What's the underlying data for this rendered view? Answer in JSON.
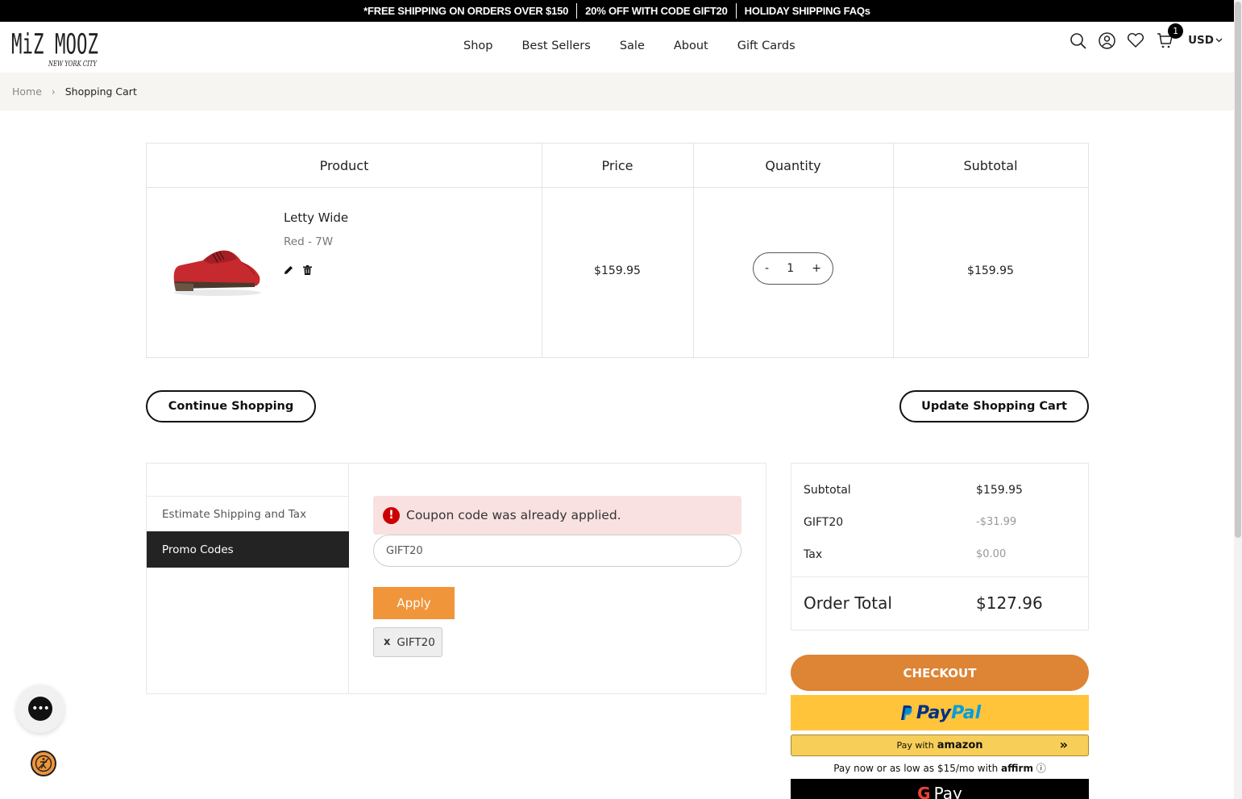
{
  "announcement": {
    "items": [
      "*FREE SHIPPING ON ORDERS OVER $150",
      "20% OFF WITH CODE GIFT20",
      "HOLIDAY SHIPPING FAQs"
    ]
  },
  "header": {
    "logo_main": "MiZ MOOZ",
    "logo_sub": "NEW YORK CITY",
    "nav": [
      "Shop",
      "Best Sellers",
      "Sale",
      "About",
      "Gift Cards"
    ],
    "cart_count": "1",
    "currency": "USD",
    "icons": [
      "search-icon",
      "account-icon",
      "wishlist-heart-icon",
      "cart-icon",
      "chevron-down-icon"
    ]
  },
  "breadcrumb": {
    "home": "Home",
    "current": "Shopping Cart"
  },
  "cart": {
    "headers": {
      "product": "Product",
      "price": "Price",
      "quantity": "Quantity",
      "subtotal": "Subtotal"
    },
    "items": [
      {
        "name": "Letty Wide",
        "variant": "Red  - 7W",
        "price": "$159.95",
        "quantity": "1",
        "subtotal": "$159.95",
        "image": "red-oxford-shoe"
      }
    ],
    "qty_minus": "-",
    "qty_plus": "+"
  },
  "actions": {
    "continue": "Continue Shopping",
    "update": "Update Shopping Cart"
  },
  "promo": {
    "tabs": [
      "Estimate Shipping and Tax",
      "Promo Codes"
    ],
    "alert": "Coupon code was already applied.",
    "input_value": "GIFT20",
    "apply": "Apply",
    "applied_code": "GIFT20",
    "remove_symbol": "x"
  },
  "summary": {
    "rows": [
      {
        "label": "Subtotal",
        "value": "$159.95"
      },
      {
        "label": "GIFT20",
        "value": "-$31.99"
      },
      {
        "label": "Tax",
        "value": "$0.00"
      }
    ],
    "order_total_label": "Order Total",
    "order_total_value": "$127.96"
  },
  "payment": {
    "checkout": "CHECKOUT",
    "paypal_a": "Pay",
    "paypal_b": "Pal",
    "amazon_prefix": "Pay with",
    "amazon_brand": "amazon",
    "affirm_text": "Pay now or as low as $15/mo with",
    "affirm_brand": "affirm",
    "gpay": "Pay",
    "gpay_g": "G"
  },
  "colors": {
    "checkout": "#dd8435",
    "apply": "#f0953a",
    "paypal": "#ffc43a",
    "alert_bg": "#f9e1e1",
    "active_tab": "#232323"
  }
}
